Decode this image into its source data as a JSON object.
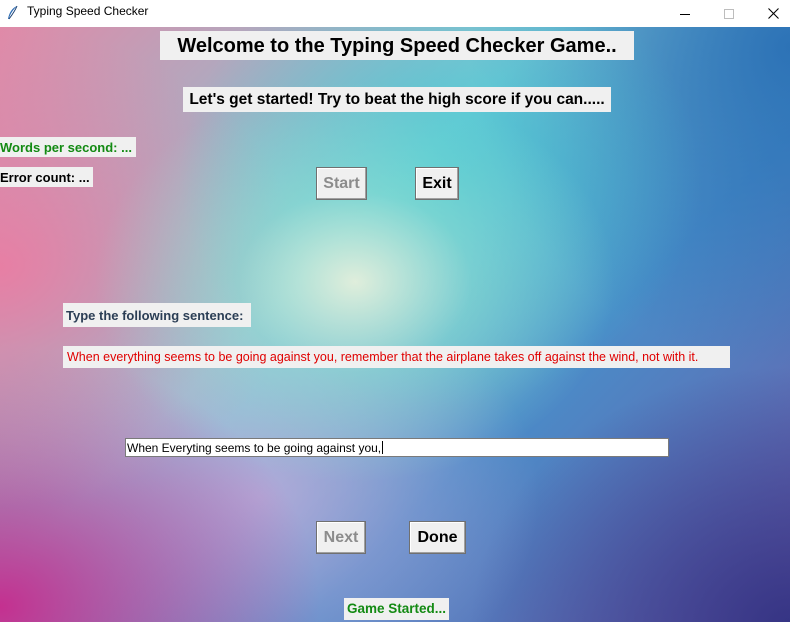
{
  "window": {
    "title": "Typing Speed Checker",
    "controls": {
      "minimize": "minimize-icon",
      "maximize": "maximize-icon",
      "close": "close-icon"
    }
  },
  "header": {
    "title": "Welcome to the Typing Speed Checker Game..",
    "subtitle": "Let's get started! Try to beat the high score if you can....."
  },
  "stats": {
    "words_per_second": "Words per second: ...",
    "error_count": "Error count: ..."
  },
  "buttons": {
    "start": "Start",
    "exit": "Exit",
    "next": "Next",
    "done": "Done"
  },
  "prompt": {
    "instruction": "Type the following sentence:",
    "sentence": "When everything seems to be going against you, remember that the airplane takes off against the wind, not with it."
  },
  "input": {
    "value": "When Everyting seems to be going against you,"
  },
  "status": {
    "text": "Game Started..."
  },
  "colors": {
    "status_green": "#138a13",
    "sentence_red": "#e00000",
    "disabled_gray": "#8c8c8c",
    "label_bg": "#f0f0f0"
  }
}
